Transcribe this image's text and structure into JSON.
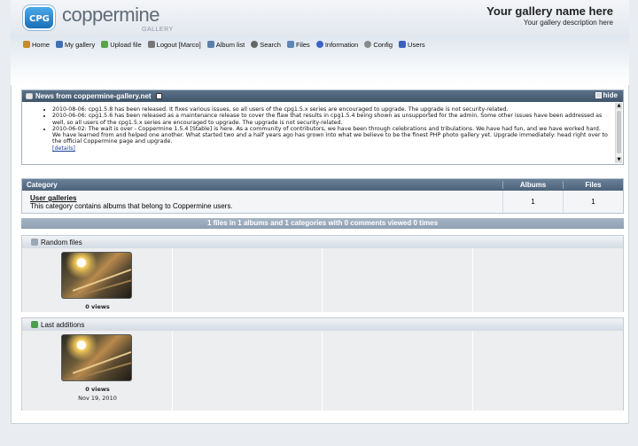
{
  "header": {
    "logo_text": "CPG",
    "brand": "coppermine",
    "brand_sub": "GALLERY",
    "site_name": "Your gallery name here",
    "site_description": "Your gallery description here"
  },
  "nav": [
    {
      "label": "Home",
      "icon": "home-icon",
      "color": "#c58b2c"
    },
    {
      "label": "My gallery",
      "icon": "gallery-icon",
      "color": "#3d6fb4"
    },
    {
      "label": "Upload file",
      "icon": "upload-icon",
      "color": "#5aa34a"
    },
    {
      "label": "Logout [Marco]",
      "icon": "logout-icon",
      "color": "#777777"
    },
    {
      "label": "Album list",
      "icon": "album-list-icon",
      "color": "#5b7fa8"
    },
    {
      "label": "Search",
      "icon": "search-icon",
      "color": "#666666"
    },
    {
      "label": "Files",
      "icon": "files-icon",
      "color": "#5f86b5"
    },
    {
      "label": "Information",
      "icon": "information-icon",
      "color": "#3b63c4"
    },
    {
      "label": "Config",
      "icon": "config-icon",
      "color": "#8a8a8a"
    },
    {
      "label": "Users",
      "icon": "users-icon",
      "color": "#3a5fc0"
    }
  ],
  "news": {
    "title": "News from coppermine-gallery.net",
    "hide_label": "hide",
    "items": [
      "2010-08-06: cpg1.5.8 has been released. It fixes various issues, so all users of the cpg1.5.x series are encouraged to upgrade. The upgrade is not security-related.",
      "2010-06-06: cpg1.5.6 has been released as a maintenance release to cover the flaw that results in cpg1.5.4 being shown as unsupported for the admin. Some other issues have been addressed as well, so all users of the cpg1.5.x series are encouraged to upgrade. The upgrade is not security-related.",
      "2010-06-02: The wait is over - Coppermine 1.5.4 [Stable] is here. As a community of contributors, we have been through celebrations and tribulations. We have had fun, and we have worked hard. We have learned from and helped one another. What started two and a half years ago has grown into what we believe to be the finest PHP photo gallery yet. Upgrade immediately: head right over to the official Coppermine page and upgrade."
    ],
    "details_link": "[details]"
  },
  "categories": {
    "headers": {
      "category": "Category",
      "albums": "Albums",
      "files": "Files"
    },
    "rows": [
      {
        "name": "User galleries",
        "description": "This category contains albums that belong to Coppermine users.",
        "albums": "1",
        "files": "1"
      }
    ]
  },
  "stats": "1 files in 1 albums and 1 categories with 0 comments viewed 0 times",
  "random_files": {
    "title": "Random files",
    "items": [
      {
        "views": "0 views"
      }
    ]
  },
  "last_additions": {
    "title": "Last additions",
    "items": [
      {
        "views": "0 views",
        "date": "Nov 19, 2010"
      }
    ]
  }
}
